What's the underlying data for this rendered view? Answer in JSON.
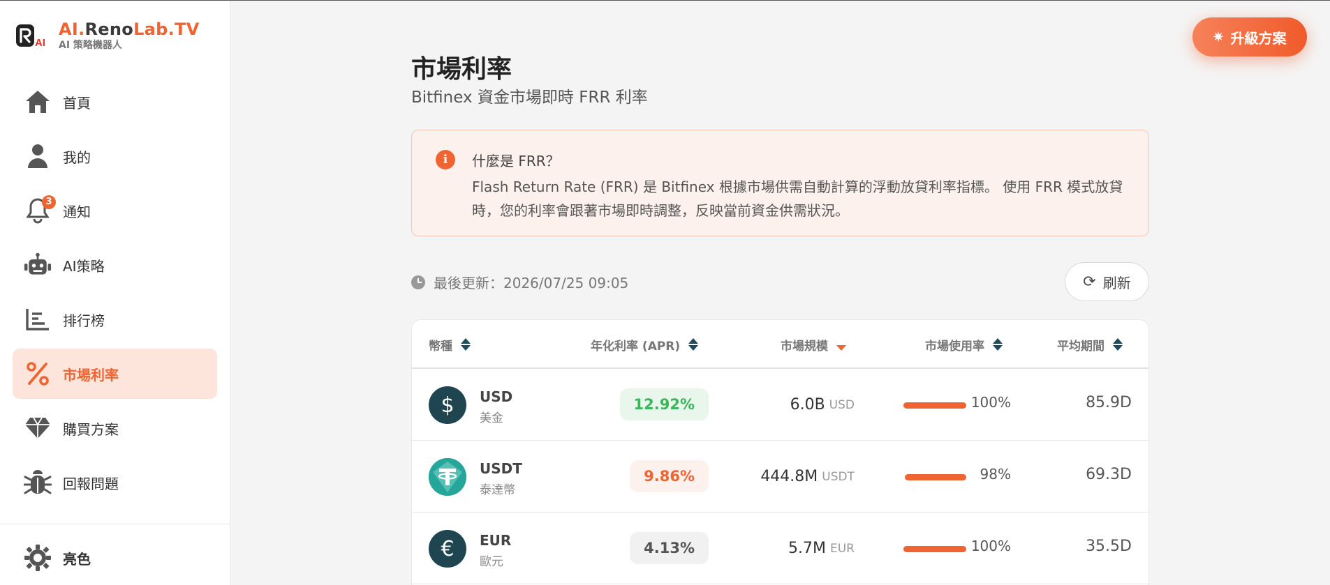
{
  "brand": {
    "name_prefix": "AI.",
    "name_mid": "Reno",
    "name_suffix": "Lab.TV",
    "subtitle": "AI 策略機器人",
    "logo_text": "AI"
  },
  "nav": {
    "items": [
      {
        "label": "首頁",
        "icon": "home-icon"
      },
      {
        "label": "我的",
        "icon": "user-icon"
      },
      {
        "label": "通知",
        "icon": "bell-icon",
        "badge": "3"
      },
      {
        "label": "AI策略",
        "icon": "robot-icon"
      },
      {
        "label": "排行榜",
        "icon": "chart-icon"
      },
      {
        "label": "市場利率",
        "icon": "percent-icon",
        "active": true
      },
      {
        "label": "購買方案",
        "icon": "diamond-icon"
      },
      {
        "label": "回報問題",
        "icon": "bug-icon"
      }
    ],
    "theme_label": "亮色"
  },
  "upgrade": {
    "label": "升級方案"
  },
  "page": {
    "title": "市場利率",
    "subtitle": "Bitfinex 資金市場即時 FRR 利率"
  },
  "info": {
    "title": "什麼是 FRR？",
    "body": "Flash Return Rate (FRR) 是 Bitfinex 根據市場供需自動計算的浮動放貸利率指標。 使用 FRR 模式放貸時，您的利率會跟著市場即時調整，反映當前資金供需狀況。"
  },
  "update": {
    "text": "最後更新：2026/07/25 09:05"
  },
  "refresh": {
    "label": "刷新"
  },
  "table": {
    "headers": {
      "coin": "幣種",
      "apr": "年化利率 (APR)",
      "market": "市場規模",
      "util": "市場使用率",
      "period": "平均期間"
    },
    "rows": [
      {
        "code": "USD",
        "name": "美金",
        "symbol": "$",
        "apr": "12.92%",
        "apr_style": "green",
        "market_value": "6.0B",
        "market_unit": "USD",
        "util": "100%",
        "util_fraction": 1.0,
        "period": "85.9D"
      },
      {
        "code": "USDT",
        "name": "泰達幣",
        "symbol": "₮",
        "apr": "9.86%",
        "apr_style": "orange",
        "market_value": "444.8M",
        "market_unit": "USDT",
        "util": "98%",
        "util_fraction": 0.98,
        "period": "69.3D"
      },
      {
        "code": "EUR",
        "name": "歐元",
        "symbol": "€",
        "apr": "4.13%",
        "apr_style": "gray",
        "market_value": "5.7M",
        "market_unit": "EUR",
        "util": "100%",
        "util_fraction": 1.0,
        "period": "35.5D"
      },
      {
        "code": "",
        "name": "",
        "symbol": "",
        "apr": "",
        "apr_style": "gray",
        "market_value": "",
        "market_unit": "",
        "util": "",
        "util_fraction": 0,
        "period": ""
      }
    ]
  },
  "colors": {
    "accent": "#f06432",
    "dark_teal": "#1f4a5a",
    "positive": "#3cb55c"
  }
}
